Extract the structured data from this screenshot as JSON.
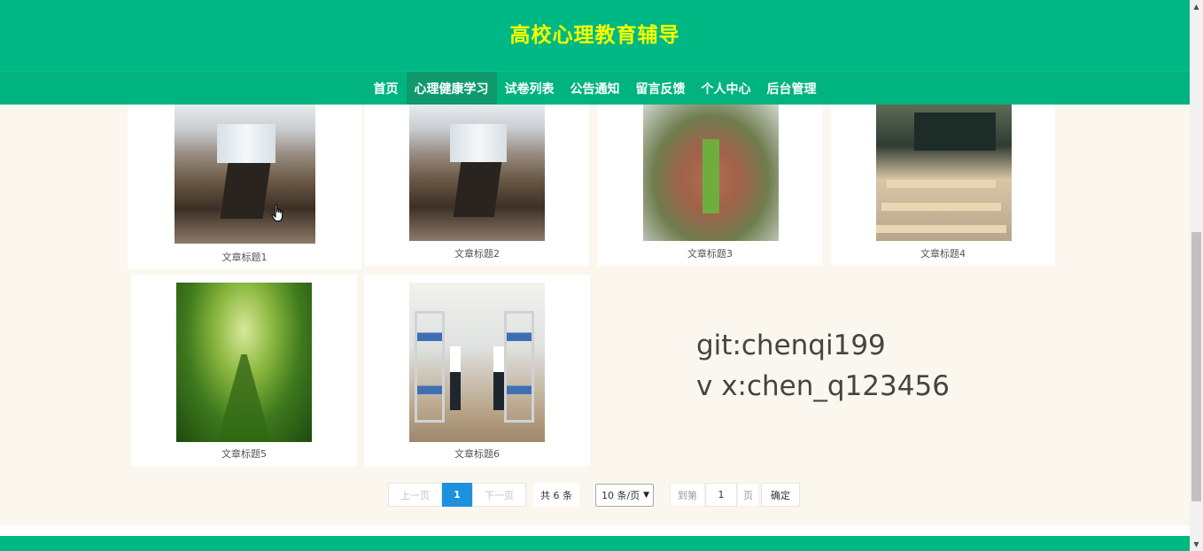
{
  "header": {
    "site_title": "高校心理教育辅导"
  },
  "nav": {
    "items": [
      {
        "label": "首页",
        "active": false
      },
      {
        "label": "心理健康学习",
        "active": true
      },
      {
        "label": "试卷列表",
        "active": false
      },
      {
        "label": "公告通知",
        "active": false
      },
      {
        "label": "留言反馈",
        "active": false
      },
      {
        "label": "个人中心",
        "active": false
      },
      {
        "label": "后台管理",
        "active": false
      }
    ]
  },
  "articles": [
    {
      "caption": "文章标题1",
      "image": "meeting-room-image"
    },
    {
      "caption": "文章标题2",
      "image": "meeting-room-image"
    },
    {
      "caption": "文章标题3",
      "image": "campus-aerial-image"
    },
    {
      "caption": "文章标题4",
      "image": "classroom-image"
    },
    {
      "caption": "文章标题5",
      "image": "forest-path-image"
    },
    {
      "caption": "文章标题6",
      "image": "dormitory-image"
    }
  ],
  "watermark": {
    "line1": "git:chenqi199",
    "line2": "v x:chen_q123456"
  },
  "pagination": {
    "prev_label": "上一页",
    "current_page": "1",
    "next_label": "下一页",
    "total_label": "共 6 条",
    "page_size_label": "10 条/页",
    "goto_label": "到第",
    "goto_value": "1",
    "page_unit": "页",
    "confirm_label": "确定"
  },
  "colors": {
    "header_bg": "#00b884",
    "title_color": "#f5ff00",
    "nav_active_bg": "#0e9a6c",
    "page_bg": "#fbf7ee",
    "pagination_active": "#1e90e0"
  }
}
